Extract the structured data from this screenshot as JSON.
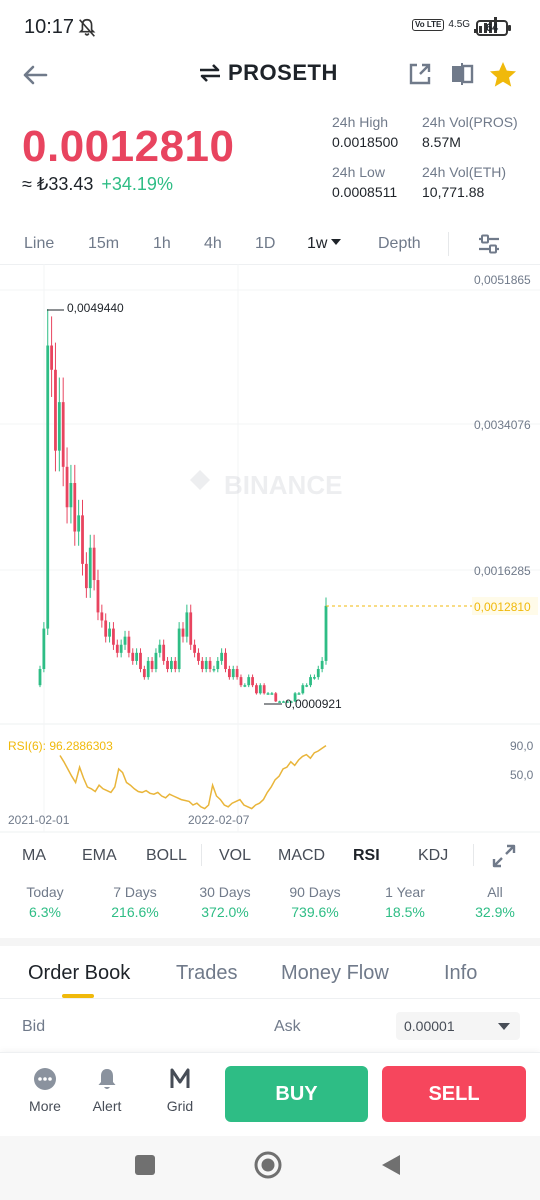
{
  "status": {
    "time": "10:17",
    "network": "4.5G",
    "volte": "Vo LTE",
    "battery": "64"
  },
  "header": {
    "title": "PROSETH"
  },
  "price": {
    "last": "0.0012810",
    "fiat": "≈ ₺33.43",
    "change": "+34.19%",
    "stats": [
      {
        "label": "24h High",
        "value": "0.0018500"
      },
      {
        "label": "24h Vol(PROS)",
        "value": "8.57M"
      },
      {
        "label": "24h Low",
        "value": "0.0008511"
      },
      {
        "label": "24h Vol(ETH)",
        "value": "10,771.88"
      }
    ]
  },
  "intervals": [
    "Line",
    "15m",
    "1h",
    "4h",
    "1D",
    "1w",
    "Depth"
  ],
  "active_interval": "1w",
  "chart": {
    "watermark": "BINANCE",
    "y_ticks": [
      "0,0051865",
      "0,0034076",
      "0,0016285"
    ],
    "last_price_label": "0,0012810",
    "high_label": "0,0049440",
    "low_label": "0,0000921",
    "rsi_label": "RSI(6): 96.2886303",
    "rsi_ticks": [
      "90,0",
      "50,0"
    ],
    "x_dates": [
      "2021-02-01",
      "2022-02-07"
    ]
  },
  "chart_data": {
    "type": "candlestick",
    "title": "",
    "xlabel": "",
    "ylabel": "",
    "x_start": "2021-02-01",
    "interval": "1w",
    "y_ticks": [
      0.0051865,
      0.0034076,
      0.0016285
    ],
    "high": 0.004944,
    "low": 9.21e-05,
    "last": 0.001281,
    "close_approx": [
      0.0005,
      0.001,
      0.0045,
      0.0042,
      0.0032,
      0.0038,
      0.003,
      0.0025,
      0.0028,
      0.0022,
      0.0024,
      0.0018,
      0.0015,
      0.002,
      0.0016,
      0.0012,
      0.0011,
      0.0009,
      0.001,
      0.0008,
      0.0007,
      0.0008,
      0.0009,
      0.0007,
      0.0006,
      0.0007,
      0.0005,
      0.0004,
      0.0006,
      0.0005,
      0.0007,
      0.0008,
      0.0006,
      0.0005,
      0.0006,
      0.0005,
      0.001,
      0.0009,
      0.0012,
      0.0008,
      0.0007,
      0.0006,
      0.0005,
      0.0006,
      0.0005,
      0.0005,
      0.0006,
      0.0007,
      0.0005,
      0.0004,
      0.0005,
      0.0004,
      0.0003,
      0.0003,
      0.0004,
      0.0003,
      0.0002,
      0.0003,
      0.0002,
      0.0002,
      0.0002,
      0.0001,
      0.0001,
      0.0001,
      0.0001,
      0.0001,
      0.0002,
      0.0002,
      0.0003,
      0.0003,
      0.0004,
      0.0004,
      0.0005,
      0.0006,
      0.001281
    ],
    "rsi6_last": 96.2886303,
    "rsi_ticks": [
      90.0,
      50.0
    ]
  },
  "indicators": [
    "MA",
    "EMA",
    "BOLL",
    "VOL",
    "MACD",
    "RSI",
    "KDJ"
  ],
  "active_indicator": "RSI",
  "performance": [
    {
      "label": "Today",
      "value": "6.3%"
    },
    {
      "label": "7 Days",
      "value": "216.6%"
    },
    {
      "label": "30 Days",
      "value": "372.0%"
    },
    {
      "label": "90 Days",
      "value": "739.6%"
    },
    {
      "label": "1 Year",
      "value": "18.5%"
    },
    {
      "label": "All",
      "value": "32.9%"
    }
  ],
  "bottom_tabs": [
    "Order Book",
    "Trades",
    "Money Flow",
    "Info"
  ],
  "order_book": {
    "bid_label": "Bid",
    "ask_label": "Ask",
    "precision": "0.00001"
  },
  "actions": {
    "more": "More",
    "alert": "Alert",
    "grid": "Grid",
    "buy": "BUY",
    "sell": "SELL"
  },
  "colors": {
    "up": "#2ebd85",
    "down": "#e8445f",
    "accent": "#f0b90b"
  }
}
